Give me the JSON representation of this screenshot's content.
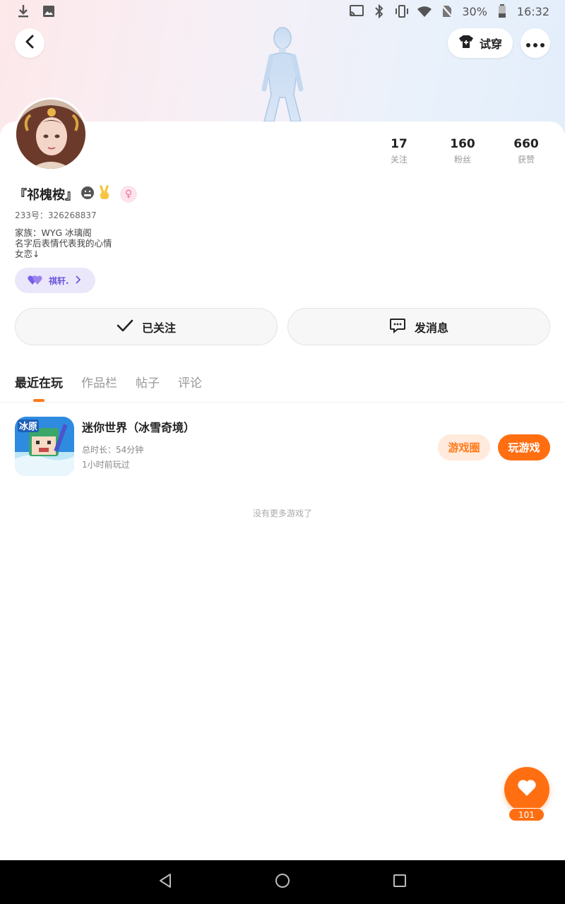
{
  "status_bar": {
    "battery": "30%",
    "time": "16:32"
  },
  "header": {
    "tryon_label": "试穿"
  },
  "profile": {
    "nickname": "『祁槐桉』",
    "gender_symbol": "♀",
    "uid": "233号：326268837",
    "bio_lines": [
      "家族：WYG 冰璃阁",
      "名字后表情代表我的心情",
      "女恋↓"
    ],
    "cp_label": "祺轩."
  },
  "stats": [
    {
      "value": "17",
      "label": "关注"
    },
    {
      "value": "160",
      "label": "粉丝"
    },
    {
      "value": "660",
      "label": "获赞"
    }
  ],
  "actions": {
    "follow_label": "已关注",
    "message_label": "发消息"
  },
  "tabs": [
    {
      "label": "最近在玩",
      "active": true
    },
    {
      "label": "作品栏",
      "active": false
    },
    {
      "label": "帖子",
      "active": false
    },
    {
      "label": "评论",
      "active": false
    }
  ],
  "games": [
    {
      "title": "迷你世界（冰雪奇境）",
      "playtime": "总时长：54分钟",
      "last_played": "1小时前玩过",
      "icon_text": "冰原",
      "circle_label": "游戏圈",
      "play_label": "玩游戏"
    }
  ],
  "empty_note": "没有更多游戏了",
  "like_count": "101",
  "colors": {
    "accent": "#ff6f12",
    "accent_soft": "#ffeadc",
    "cp_purple": "#6a55d8"
  }
}
